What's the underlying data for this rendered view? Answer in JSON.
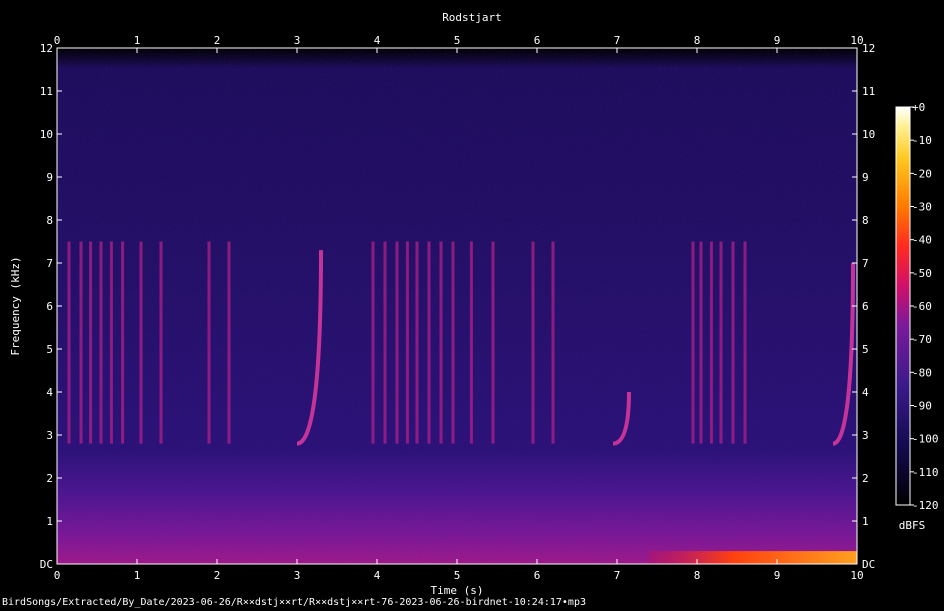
{
  "chart_data": {
    "type": "heatmap",
    "title": "Rodstjart",
    "xlabel": "Time (s)",
    "ylabel": "Frequency (kHz)",
    "xlim": [
      0,
      10
    ],
    "ylim": [
      0,
      12
    ],
    "x_ticks": [
      "0",
      "1",
      "2",
      "3",
      "4",
      "5",
      "6",
      "7",
      "8",
      "9",
      "10"
    ],
    "y_ticks": [
      "DC",
      "1",
      "2",
      "3",
      "4",
      "5",
      "6",
      "7",
      "8",
      "9",
      "10",
      "11",
      "12"
    ],
    "colorbar": {
      "label": "dBFS",
      "ticks": [
        "+0",
        "-10",
        "-20",
        "-30",
        "-40",
        "-50",
        "-60",
        "-70",
        "-80",
        "-90",
        "-100",
        "-110",
        "-120"
      ],
      "range": [
        -120,
        0
      ],
      "colors": [
        "#000000",
        "#120a4a",
        "#3a1a8a",
        "#8a1a9a",
        "#e0105a",
        "#ff5a10",
        "#ffb000",
        "#fff070",
        "#ffffff"
      ]
    },
    "call_strips_s": [
      0.15,
      0.3,
      0.42,
      0.55,
      0.68,
      0.82,
      1.05,
      1.3,
      1.9,
      2.15,
      3.95,
      4.1,
      4.25,
      4.38,
      4.5,
      4.65,
      4.8,
      4.95,
      5.18,
      5.45,
      5.95,
      6.2,
      7.95,
      8.05,
      8.18,
      8.3,
      8.45,
      8.6
    ],
    "strip_range_khz": [
      2.8,
      7.5
    ],
    "chirps": [
      {
        "t_start": 3.0,
        "t_end": 3.3,
        "f_low_khz": 2.8,
        "f_high_khz": 7.3
      },
      {
        "t_start": 6.95,
        "t_end": 7.15,
        "f_low_khz": 2.8,
        "f_high_khz": 4.0
      },
      {
        "t_start": 9.7,
        "t_end": 9.95,
        "f_low_khz": 2.8,
        "f_high_khz": 7.0
      }
    ],
    "hot_band": {
      "t_start": 7.4,
      "t_end": 10,
      "f_high_khz": 0.3
    }
  },
  "footer": "BirdSongs/Extracted/By_Date/2023-06-26/R××dstj××rt/R××dstj××rt-76-2023-06-26-birdnet-10:24:17•mp3"
}
